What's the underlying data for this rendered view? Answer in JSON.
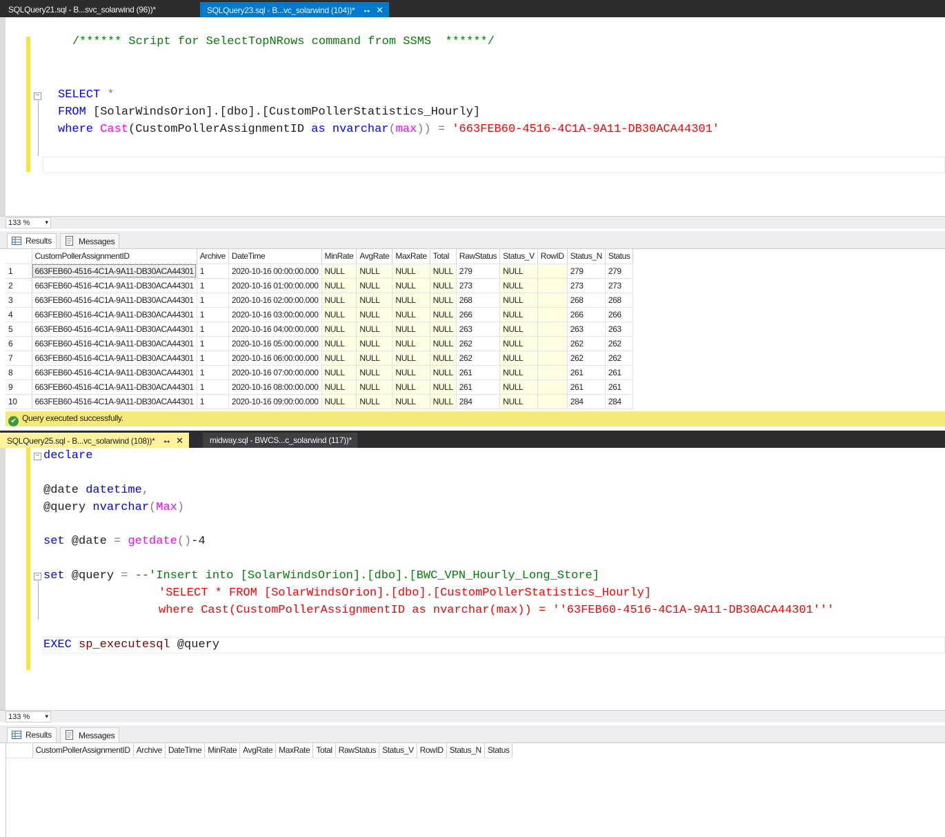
{
  "top_tabs": [
    {
      "label": "SQLQuery21.sql - B...svc_solarwind (96))*"
    },
    {
      "label": "SQLQuery23.sql - B...vc_solarwind (104))*"
    }
  ],
  "editor1": {
    "comment": "/****** Script for SelectTopNRows command from SSMS  ******/",
    "line_select_kw": "SELECT",
    "line_select_star": " *",
    "line_from_kw": "FROM",
    "line_from_rest": " [SolarWindsOrion].[dbo].[CustomPollerStatistics_Hourly]",
    "line_where_kw": "where",
    "line_where_fn": "Cast",
    "line_where_a": "(CustomPollerAssignmentID ",
    "line_where_as": "as",
    "line_where_type": "nvarchar",
    "line_where_max": "max",
    "line_where_close": "))",
    "line_where_eq": " = ",
    "line_where_str": "'663FEB60-4516-4C1A-9A11-DB30ACA44301'"
  },
  "zoom1": "133 %",
  "results_tabs": {
    "results": "Results",
    "messages": "Messages"
  },
  "grid1": {
    "columns": [
      "CustomPollerAssignmentID",
      "Archive",
      "DateTime",
      "MinRate",
      "AvgRate",
      "MaxRate",
      "Total",
      "RawStatus",
      "Status_V",
      "RowID",
      "Status_N",
      "Status"
    ],
    "rows": [
      [
        "1",
        "663FEB60-4516-4C1A-9A11-DB30ACA44301",
        "1",
        "2020-10-16 00:00:00.000",
        "NULL",
        "NULL",
        "NULL",
        "NULL",
        "279",
        "NULL",
        "",
        "279",
        "279"
      ],
      [
        "2",
        "663FEB60-4516-4C1A-9A11-DB30ACA44301",
        "1",
        "2020-10-16 01:00:00.000",
        "NULL",
        "NULL",
        "NULL",
        "NULL",
        "273",
        "NULL",
        "",
        "273",
        "273"
      ],
      [
        "3",
        "663FEB60-4516-4C1A-9A11-DB30ACA44301",
        "1",
        "2020-10-16 02:00:00.000",
        "NULL",
        "NULL",
        "NULL",
        "NULL",
        "268",
        "NULL",
        "",
        "268",
        "268"
      ],
      [
        "4",
        "663FEB60-4516-4C1A-9A11-DB30ACA44301",
        "1",
        "2020-10-16 03:00:00.000",
        "NULL",
        "NULL",
        "NULL",
        "NULL",
        "266",
        "NULL",
        "",
        "266",
        "266"
      ],
      [
        "5",
        "663FEB60-4516-4C1A-9A11-DB30ACA44301",
        "1",
        "2020-10-16 04:00:00.000",
        "NULL",
        "NULL",
        "NULL",
        "NULL",
        "263",
        "NULL",
        "",
        "263",
        "263"
      ],
      [
        "6",
        "663FEB60-4516-4C1A-9A11-DB30ACA44301",
        "1",
        "2020-10-16 05:00:00.000",
        "NULL",
        "NULL",
        "NULL",
        "NULL",
        "262",
        "NULL",
        "",
        "262",
        "262"
      ],
      [
        "7",
        "663FEB60-4516-4C1A-9A11-DB30ACA44301",
        "1",
        "2020-10-16 06:00:00.000",
        "NULL",
        "NULL",
        "NULL",
        "NULL",
        "262",
        "NULL",
        "",
        "262",
        "262"
      ],
      [
        "8",
        "663FEB60-4516-4C1A-9A11-DB30ACA44301",
        "1",
        "2020-10-16 07:00:00.000",
        "NULL",
        "NULL",
        "NULL",
        "NULL",
        "261",
        "NULL",
        "",
        "261",
        "261"
      ],
      [
        "9",
        "663FEB60-4516-4C1A-9A11-DB30ACA44301",
        "1",
        "2020-10-16 08:00:00.000",
        "NULL",
        "NULL",
        "NULL",
        "NULL",
        "261",
        "NULL",
        "",
        "261",
        "261"
      ],
      [
        "10",
        "663FEB60-4516-4C1A-9A11-DB30ACA44301",
        "1",
        "2020-10-16 09:00:00.000",
        "NULL",
        "NULL",
        "NULL",
        "NULL",
        "284",
        "NULL",
        "",
        "284",
        "284"
      ]
    ]
  },
  "status1": "Query executed successfully.",
  "bottom_tabs": [
    {
      "label": "SQLQuery25.sql - B...vc_solarwind (108))*"
    },
    {
      "label": "midway.sql - BWCS...c_solarwind (117))*"
    }
  ],
  "editor2": {
    "declare": "declare",
    "date_var": "@date ",
    "date_type": "datetime",
    "date_comma": ",",
    "query_var": "@query ",
    "query_type": "nvarchar",
    "query_max": "Max",
    "set_kw": "set",
    "set_date_rest": " @date ",
    "set_date_eq": "=",
    "set_date_fn": "getdate",
    "set_date_paren": "()",
    "set_date_tail": "-4",
    "set_query_rest": " @query ",
    "set_query_eq": "=",
    "set_query_comment": " --'Insert into [SolarWindsOrion].[dbo].[BWC_VPN_Hourly_Long_Store]",
    "str_line1": "'SELECT * FROM [SolarWindsOrion].[dbo].[CustomPollerStatistics_Hourly]",
    "str_line2": "where Cast(CustomPollerAssignmentID as nvarchar(max)) = ''63FEB60-4516-4C1A-9A11-DB30ACA44301'''",
    "exec_kw": "EXEC",
    "exec_proc": " sp_executesql",
    "exec_arg": " @query"
  },
  "zoom2": "133 %",
  "grid2": {
    "columns": [
      "CustomPollerAssignmentID",
      "Archive",
      "DateTime",
      "MinRate",
      "AvgRate",
      "MaxRate",
      "Total",
      "RawStatus",
      "Status_V",
      "RowID",
      "Status_N",
      "Status"
    ]
  },
  "colors": {
    "tab_blue": "#007acc",
    "tab_yellow": "#fff29d",
    "status_yellow": "#f5e97a",
    "keyword": "#0000ff",
    "string": "#ff0000",
    "comment": "#008000",
    "function": "#ff00ff"
  }
}
